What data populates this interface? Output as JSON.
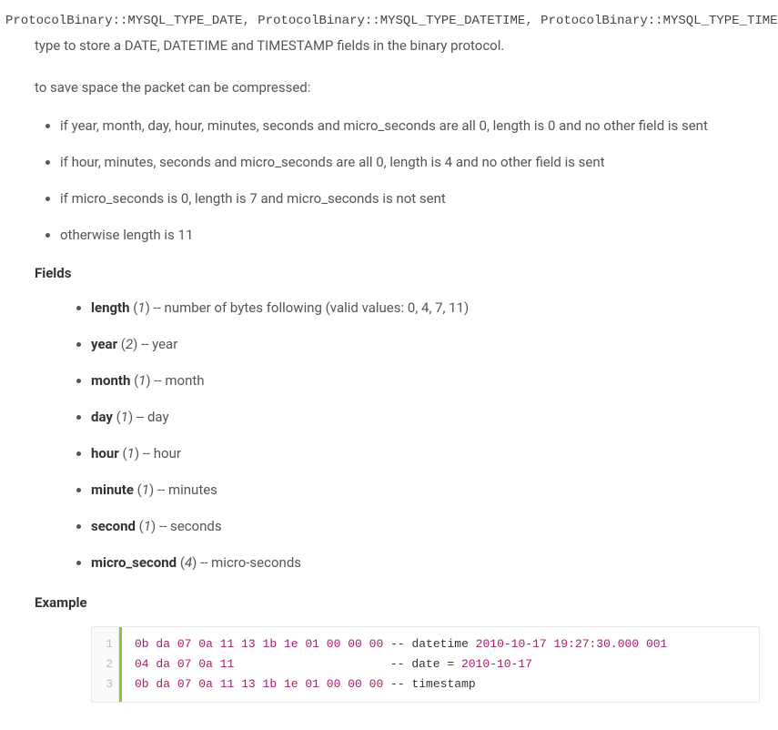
{
  "types": {
    "t1": "ProtocolBinary::MYSQL_TYPE_DATE",
    "t2": "ProtocolBinary::MYSQL_TYPE_DATETIME",
    "t3": "ProtocolBinary::MYSQL_TYPE_TIMESTAMP",
    "sep": ", ",
    "end": ":"
  },
  "description": "type to store a DATE, DATETIME and TIMESTAMP fields in the binary protocol.",
  "intro": "to save space the packet can be compressed:",
  "rules": [
    "if year, month, day, hour, minutes, seconds and micro_seconds are all 0, length is 0 and no other field is sent",
    "if hour, minutes, seconds and micro_seconds are all 0, length is 4 and no other field is sent",
    "if micro_seconds is 0, length is 7 and micro_seconds is not sent",
    "otherwise length is 11"
  ],
  "fieldsLabel": "Fields",
  "fields": [
    {
      "name": "length",
      "num": "1",
      "desc": "number of bytes following (valid values: 0, 4, 7, 11)"
    },
    {
      "name": "year",
      "num": "2",
      "desc": "year"
    },
    {
      "name": "month",
      "num": "1",
      "desc": "month"
    },
    {
      "name": "day",
      "num": "1",
      "desc": "day"
    },
    {
      "name": "hour",
      "num": "1",
      "desc": "hour"
    },
    {
      "name": "minute",
      "num": "1",
      "desc": "minutes"
    },
    {
      "name": "second",
      "num": "1",
      "desc": "seconds"
    },
    {
      "name": "micro_second",
      "num": "4",
      "desc": "micro-seconds"
    }
  ],
  "exampleLabel": "Example",
  "example": {
    "lineNums": [
      "1",
      "2",
      "3"
    ],
    "line1": {
      "bytes": [
        "0b",
        "da",
        "07",
        "0a",
        "11",
        "13",
        "1b",
        "1e",
        "01",
        "00",
        "00",
        "00"
      ],
      "comment_prefix": " -- datetime ",
      "date": "2010-10-17",
      "time": "19:27:30.000",
      "suffix": "001"
    },
    "line2": {
      "bytes": [
        "04",
        "da",
        "07",
        "0a",
        "11"
      ],
      "padding": "                     ",
      "comment_prefix": " -- date = ",
      "date": "2010-10-17"
    },
    "line3": {
      "bytes": [
        "0b",
        "da",
        "07",
        "0a",
        "11",
        "13",
        "1b",
        "1e",
        "01",
        "00",
        "00",
        "00"
      ],
      "comment": " -- timestamp"
    }
  }
}
